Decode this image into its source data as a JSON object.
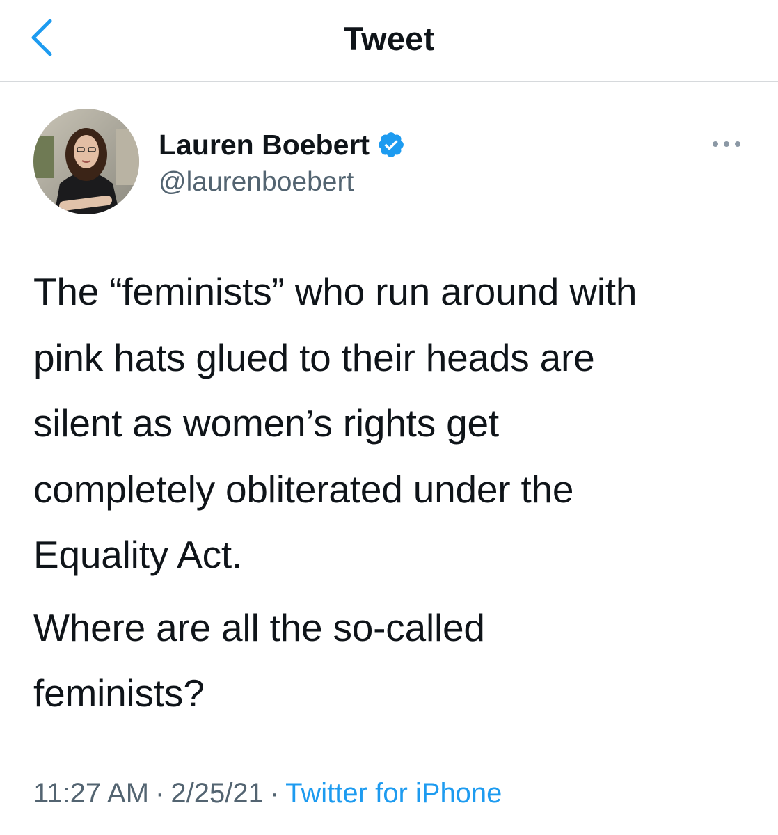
{
  "nav": {
    "title": "Tweet",
    "back_icon": "chevron-left-icon"
  },
  "author": {
    "display_name": "Lauren Boebert",
    "handle": "@laurenboebert",
    "verified_icon": "verified-badge-icon",
    "more_icon": "ellipsis-icon"
  },
  "tweet": {
    "paragraphs": [
      "The “feminists” who run around with\npink hats glued to their heads are\nsilent as women’s rights get\ncompletely obliterated under the\nEquality Act.",
      "Where are all the so-called\nfeminists?"
    ]
  },
  "meta": {
    "time": "11:27 AM",
    "date": "2/25/21",
    "separator": "·",
    "source": "Twitter for iPhone"
  },
  "colors": {
    "accent": "#1d9bf0",
    "text": "#0f1419",
    "secondary": "#536471",
    "divider": "#d6d9dc"
  }
}
